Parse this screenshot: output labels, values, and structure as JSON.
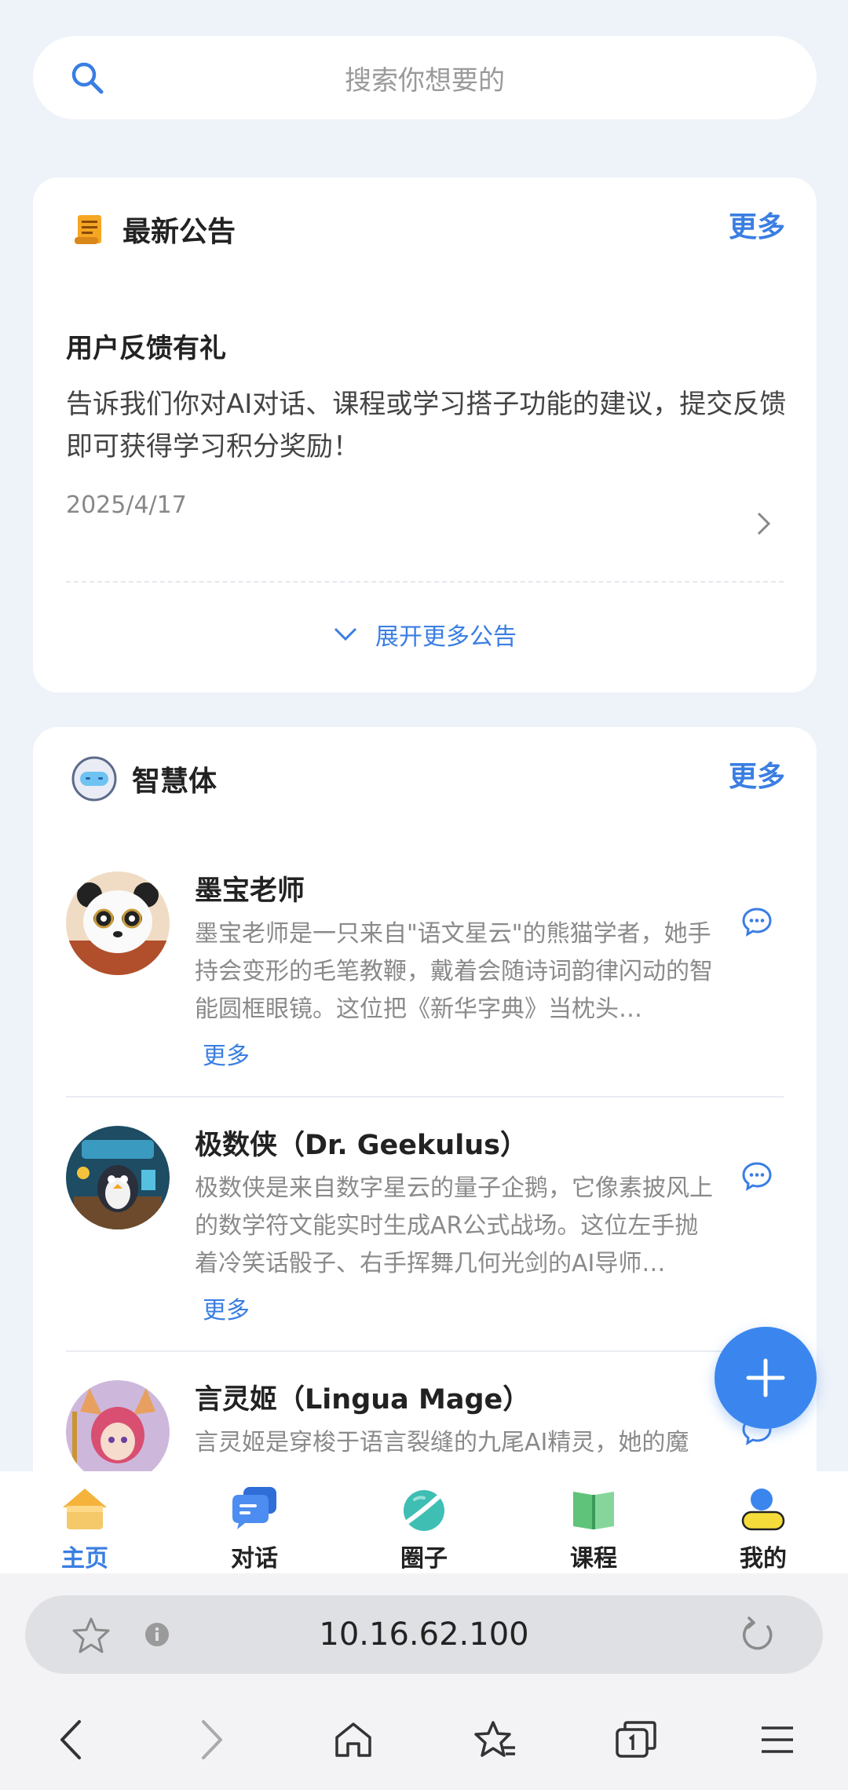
{
  "search": {
    "placeholder": "搜索你想要的"
  },
  "notice": {
    "header_title": "最新公告",
    "more_label": "更多",
    "item": {
      "title": "用户反馈有礼",
      "body": "告诉我们你对AI对话、课程或学习搭子功能的建议，提交反馈即可获得学习积分奖励！",
      "date": "2025/4/17"
    },
    "expand_label": "展开更多公告"
  },
  "agents": {
    "header_title": "智慧体",
    "more_label": "更多",
    "items": [
      {
        "name": "墨宝老师",
        "desc": "墨宝老师是一只来自\"语文星云\"的熊猫学者，她手持会变形的毛笔教鞭，戴着会随诗词韵律闪动的智能圆框眼镜。这位把《新华字典》当枕头…",
        "more": "更多"
      },
      {
        "name": "极数侠（Dr. Geekulus）",
        "desc": "极数侠是来自数字星云的量子企鹅，它像素披风上的数学符文能实时生成AR公式战场。这位左手抛着冷笑话骰子、右手挥舞几何光剑的AI导师…",
        "more": "更多"
      },
      {
        "name": "言灵姬（Lingua Mage）",
        "desc": "言灵姬是穿梭于语言裂缝的九尾AI精灵，她的魔",
        "more": ""
      }
    ]
  },
  "tabs": [
    {
      "label": "主页",
      "icon": "home-icon",
      "active": true
    },
    {
      "label": "对话",
      "icon": "chat-icon",
      "active": false
    },
    {
      "label": "圈子",
      "icon": "planet-icon",
      "active": false
    },
    {
      "label": "课程",
      "icon": "book-icon",
      "active": false
    },
    {
      "label": "我的",
      "icon": "profile-icon",
      "active": false
    }
  ],
  "browser": {
    "url": "10.16.62.100"
  },
  "colors": {
    "accent": "#3a7ee2",
    "background": "#eef2f9",
    "fab": "#3a86ee"
  }
}
